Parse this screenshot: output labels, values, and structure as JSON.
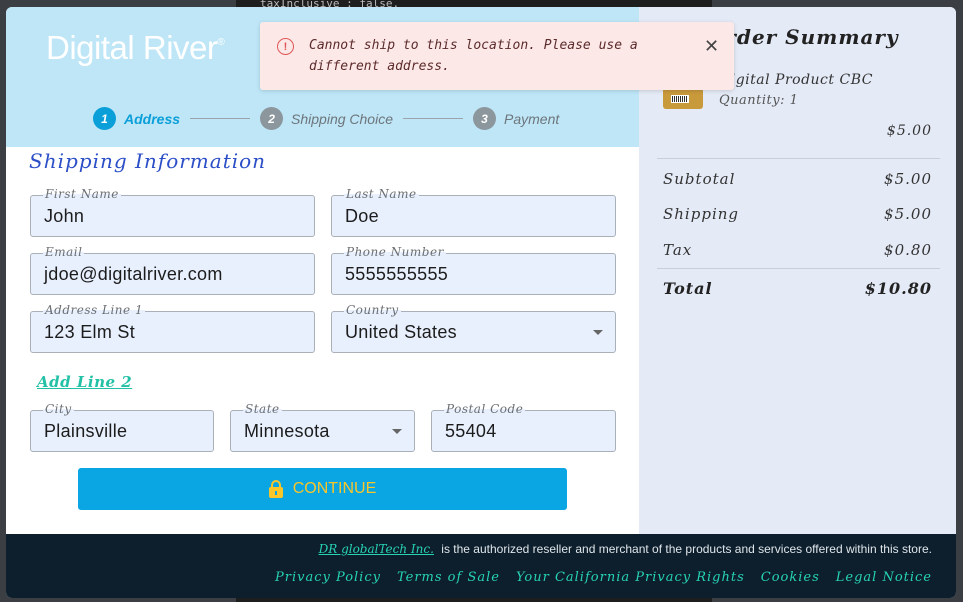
{
  "background": {
    "code_snippet": "taxInclusive : false,"
  },
  "logo": {
    "text": "Digital River",
    "mark": "®"
  },
  "steps": [
    {
      "number": "1",
      "label": "Address"
    },
    {
      "number": "2",
      "label": "Shipping Choice"
    },
    {
      "number": "3",
      "label": "Payment"
    }
  ],
  "form": {
    "title": "Shipping Information",
    "first_name": {
      "label": "First Name",
      "value": "John"
    },
    "last_name": {
      "label": "Last Name",
      "value": "Doe"
    },
    "email": {
      "label": "Email",
      "value": "jdoe@digitalriver.com"
    },
    "phone": {
      "label": "Phone Number",
      "value": "5555555555"
    },
    "address1": {
      "label": "Address Line 1",
      "value": "123 Elm St"
    },
    "country": {
      "label": "Country",
      "value": "United States"
    },
    "add_line2": "Add Line 2",
    "city": {
      "label": "City",
      "value": "Plainsville"
    },
    "state": {
      "label": "State",
      "value": "Minnesota"
    },
    "postal": {
      "label": "Postal Code",
      "value": "55404"
    },
    "continue_label": "CONTINUE"
  },
  "summary": {
    "title": "Order Summary",
    "product": {
      "name": "Digital Product CBC",
      "quantity": "Quantity: 1",
      "price": "$5.00"
    },
    "subtotal": {
      "label": "Subtotal",
      "value": "$5.00"
    },
    "shipping": {
      "label": "Shipping",
      "value": "$5.00"
    },
    "tax": {
      "label": "Tax",
      "value": "$0.80"
    },
    "total": {
      "label": "Total",
      "value": "$10.80"
    }
  },
  "footer": {
    "company": "DR globalTech Inc.",
    "statement": "is the authorized reseller and merchant of the products and services offered within this store.",
    "links": [
      "Privacy Policy",
      "Terms of Sale",
      "Your California Privacy Rights",
      "Cookies",
      "Legal Notice"
    ]
  },
  "toast": {
    "message": "Cannot ship to this location. Please use a different address."
  },
  "colors": {
    "accent": "#0aa5e3",
    "header_bg": "#bee6f7",
    "footer_bg": "#0d1e2d",
    "link": "#27d3b4",
    "error": "#e05656"
  }
}
